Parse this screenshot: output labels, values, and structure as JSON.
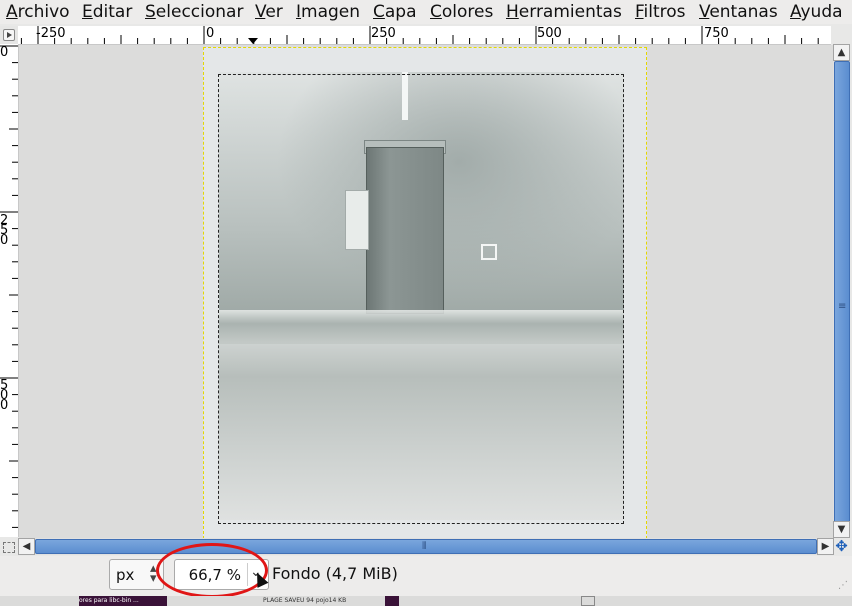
{
  "menubar": {
    "items": [
      {
        "label": "Archivo"
      },
      {
        "label": "Editar"
      },
      {
        "label": "Seleccionar"
      },
      {
        "label": "Ver"
      },
      {
        "label": "Imagen"
      },
      {
        "label": "Capa"
      },
      {
        "label": "Colores"
      },
      {
        "label": "Herramientas"
      },
      {
        "label": "Filtros"
      },
      {
        "label": "Ventanas"
      },
      {
        "label": "Ayuda"
      }
    ]
  },
  "rulers": {
    "horizontal_labels": [
      "-250",
      "0",
      "250",
      "500",
      "750"
    ],
    "vertical_labels": [
      "0",
      "250",
      "500"
    ]
  },
  "statusbar": {
    "unit": "px",
    "zoom": "66,7 %",
    "layer_info": "Fondo (4,7 MiB)"
  },
  "taskbar": {
    "items": [
      "ores para libc-bin ...",
      "PLAGE SAVEU 94 pojo14 KB"
    ]
  },
  "colors": {
    "scroll_thumb": "#5b8dd0",
    "annotation": "#e01616",
    "selection_border": "#e3d800"
  }
}
